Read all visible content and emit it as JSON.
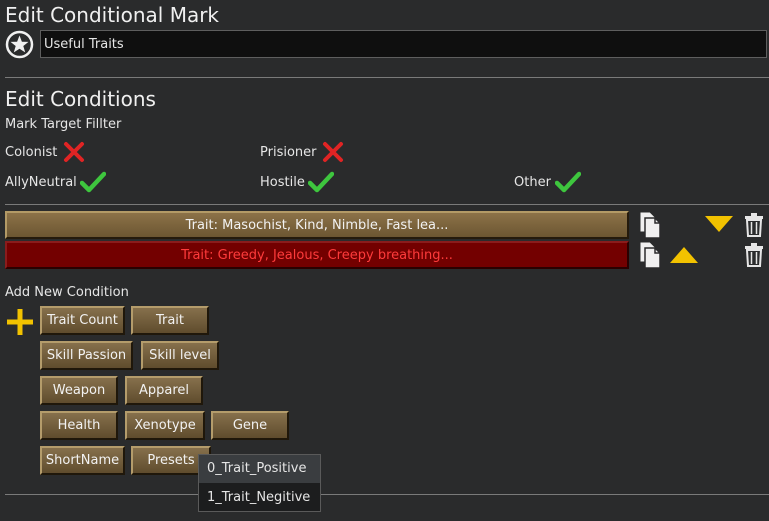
{
  "dialog": {
    "title": "Edit Conditional Mark",
    "icon": "star-circle-icon",
    "name_value": "Useful Traits"
  },
  "conditions": {
    "title": "Edit Conditions",
    "filter_label": "Mark Target Fillter",
    "filters": [
      {
        "label": "Colonist",
        "enabled": false
      },
      {
        "label": "Prisioner",
        "enabled": false
      },
      {
        "label": "AllyNeutral",
        "enabled": true
      },
      {
        "label": "Hostile",
        "enabled": true
      },
      {
        "label": "Other",
        "enabled": true
      }
    ]
  },
  "condition_rows": [
    {
      "label": "Trait: Masochist, Kind, Nimble, Fast lea...",
      "state": "normal"
    },
    {
      "label": "Trait: Greedy, Jealous, Creepy breathing...",
      "state": "negated"
    }
  ],
  "add_condition": {
    "title": "Add New Condition",
    "buttons": {
      "trait_count": "Trait Count",
      "trait": "Trait",
      "skill_passion": "Skill Passion",
      "skill_level": "Skill level",
      "weapon": "Weapon",
      "apparel": "Apparel",
      "health": "Health",
      "xenotype": "Xenotype",
      "gene": "Gene",
      "short_name": "ShortName",
      "presets": "Presets"
    }
  },
  "presets_menu": {
    "items": [
      "0_Trait_Positive",
      "1_Trait_Negitive"
    ],
    "highlighted_index": 0
  },
  "colors": {
    "check": "#3ec63e",
    "cross": "#e02424",
    "gold": "#f2c200",
    "negated_text": "#ff3b3b"
  }
}
